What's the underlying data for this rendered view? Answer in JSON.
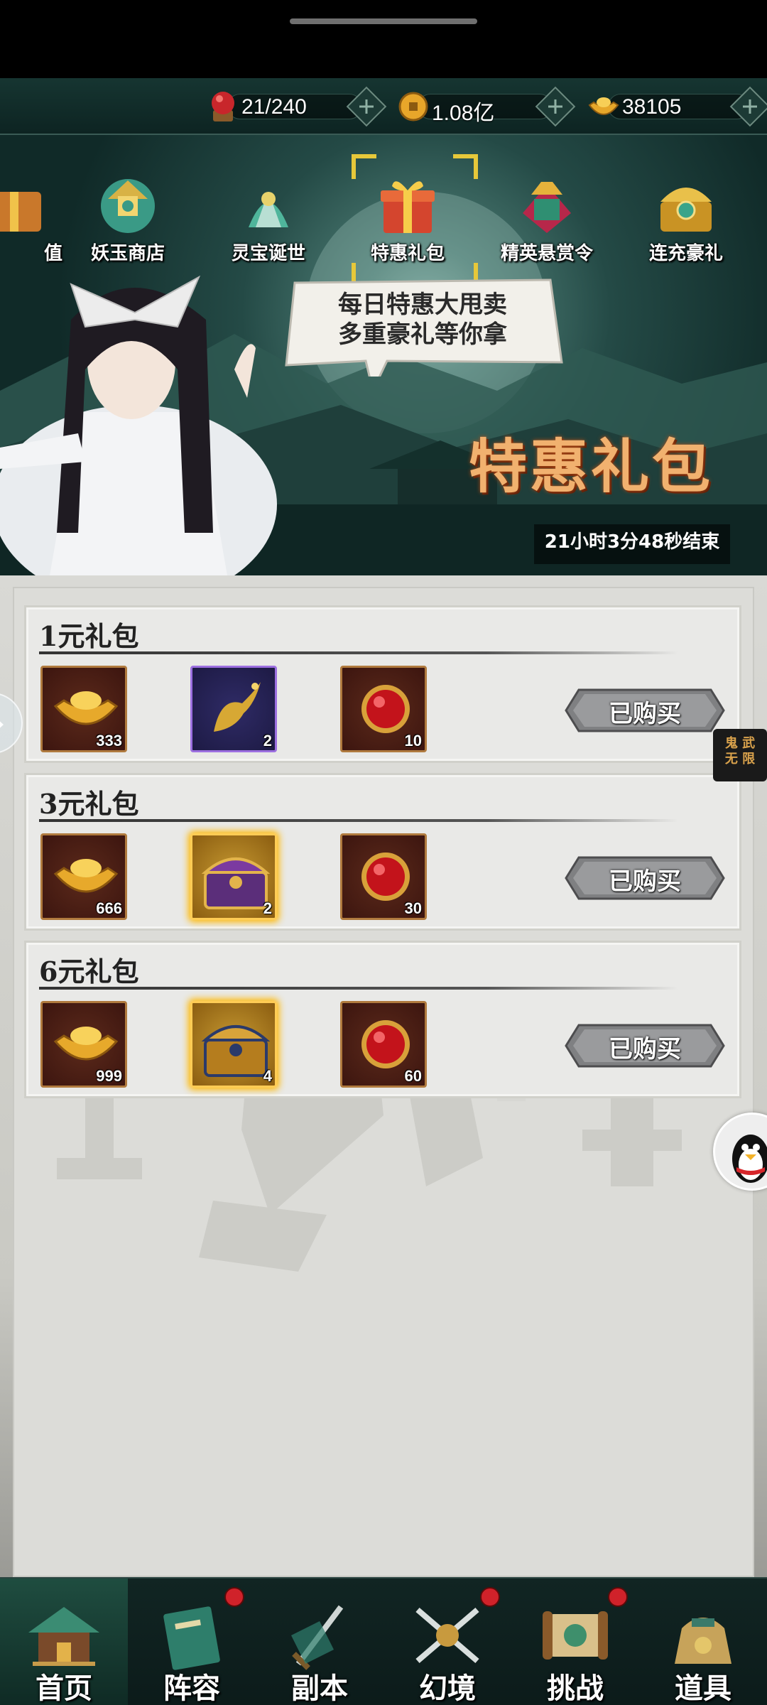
{
  "resources": [
    {
      "icon": "red-orb-icon",
      "value": "21/240"
    },
    {
      "icon": "coin-icon",
      "value": "1.08亿"
    },
    {
      "icon": "gold-ingot-icon",
      "value": "38105"
    }
  ],
  "banner": {
    "nav": [
      {
        "label": "值",
        "icon": "partial-gift-icon"
      },
      {
        "label": "妖玉商店",
        "icon": "jade-shop-icon"
      },
      {
        "label": "灵宝诞世",
        "icon": "spirit-treasure-icon"
      },
      {
        "label": "特惠礼包",
        "icon": "gift-box-icon",
        "selected": true
      },
      {
        "label": "精英悬赏令",
        "icon": "bounty-icon"
      },
      {
        "label": "连充豪礼",
        "icon": "treasure-chest-icon"
      }
    ],
    "speech_line1": "每日特惠大甩卖",
    "speech_line2": "多重豪礼等你拿",
    "title": "特惠礼包",
    "timer": "21小时3分48秒结束"
  },
  "packages": [
    {
      "name": "1元礼包",
      "button": "已购买",
      "items": [
        {
          "icon": "gold-ingot-icon",
          "qty": "333"
        },
        {
          "icon": "golden-dragon-icon",
          "qty": "2"
        },
        {
          "icon": "red-orb-icon",
          "qty": "10"
        }
      ]
    },
    {
      "name": "3元礼包",
      "button": "已购买",
      "items": [
        {
          "icon": "gold-ingot-icon",
          "qty": "666"
        },
        {
          "icon": "purple-chest-icon",
          "qty": "2"
        },
        {
          "icon": "red-orb-icon",
          "qty": "30"
        }
      ]
    },
    {
      "name": "6元礼包",
      "button": "已购买",
      "items": [
        {
          "icon": "gold-ingot-icon",
          "qty": "999"
        },
        {
          "icon": "gold-chest-icon",
          "qty": "4"
        },
        {
          "icon": "red-orb-icon",
          "qty": "60"
        }
      ]
    }
  ],
  "side_tag": {
    "line1": "鬼 武",
    "line2": "无 限"
  },
  "bottom_nav": [
    {
      "label": "首页",
      "icon": "home-pavilion-icon",
      "badge": false
    },
    {
      "label": "阵容",
      "icon": "lineup-book-icon",
      "badge": true
    },
    {
      "label": "副本",
      "icon": "dungeon-sword-icon",
      "badge": false
    },
    {
      "label": "幻境",
      "icon": "crossed-swords-icon",
      "badge": true
    },
    {
      "label": "挑战",
      "icon": "challenge-scroll-icon",
      "badge": true
    },
    {
      "label": "道具",
      "icon": "item-bag-icon",
      "badge": false
    }
  ]
}
